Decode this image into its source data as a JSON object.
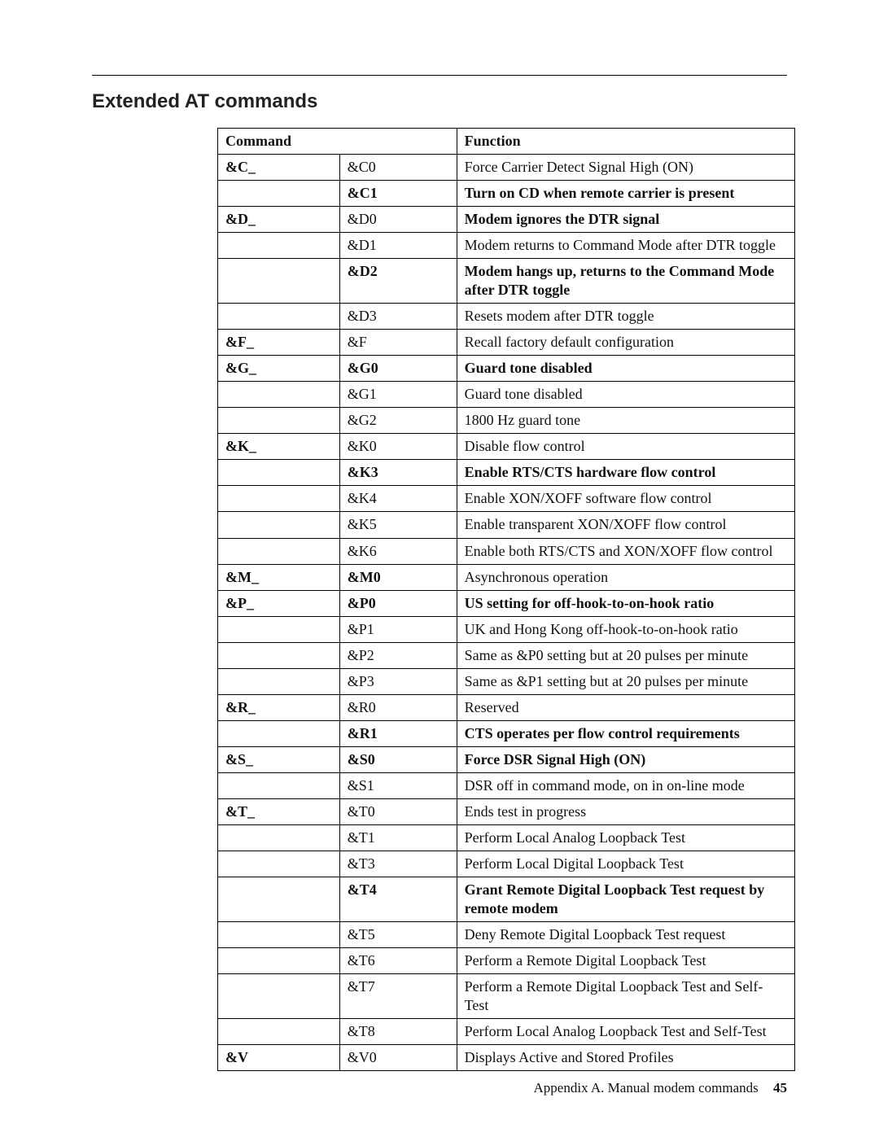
{
  "title": "Extended AT commands",
  "headers": {
    "command": "Command",
    "function": "Function"
  },
  "rows": [
    {
      "grp": "&C_",
      "cmd": "&C0",
      "func": "Force Carrier Detect Signal High (ON)",
      "grpBold": true
    },
    {
      "grp": "",
      "cmd": "&C1",
      "func": "Turn on CD when remote carrier is present",
      "cmdBold": true,
      "funcBold": true
    },
    {
      "grp": "&D_",
      "cmd": "&D0",
      "func": "Modem ignores the DTR signal",
      "grpBold": true,
      "funcBold": true
    },
    {
      "grp": "",
      "cmd": "&D1",
      "func": "Modem returns to Command Mode after DTR toggle"
    },
    {
      "grp": "",
      "cmd": "&D2",
      "func": "Modem hangs up, returns to the Command Mode after DTR toggle",
      "cmdBold": true,
      "funcBold": true
    },
    {
      "grp": "",
      "cmd": "&D3",
      "func": "Resets modem after DTR toggle"
    },
    {
      "grp": "&F_",
      "cmd": "&F",
      "func": "Recall factory default configuration",
      "grpBold": true
    },
    {
      "grp": "&G_",
      "cmd": "&G0",
      "func": "Guard tone disabled",
      "grpBold": true,
      "cmdBold": true,
      "funcBold": true
    },
    {
      "grp": "",
      "cmd": "&G1",
      "func": "Guard tone disabled"
    },
    {
      "grp": "",
      "cmd": "&G2",
      "func": "1800 Hz guard tone"
    },
    {
      "grp": "&K_",
      "cmd": "&K0",
      "func": "Disable flow control",
      "grpBold": true
    },
    {
      "grp": "",
      "cmd": "&K3",
      "func": "Enable RTS/CTS hardware flow control",
      "cmdBold": true,
      "funcBold": true
    },
    {
      "grp": "",
      "cmd": "&K4",
      "func": "Enable XON/XOFF software flow control"
    },
    {
      "grp": "",
      "cmd": "&K5",
      "func": "Enable transparent XON/XOFF flow control"
    },
    {
      "grp": "",
      "cmd": "&K6",
      "func": "Enable both RTS/CTS and XON/XOFF flow control"
    },
    {
      "grp": "&M_",
      "cmd": "&M0",
      "func": "Asynchronous operation",
      "grpBold": true,
      "cmdBold": true
    },
    {
      "grp": "&P_",
      "cmd": "&P0",
      "func": "US setting for off-hook-to-on-hook ratio",
      "grpBold": true,
      "cmdBold": true,
      "funcBold": true
    },
    {
      "grp": "",
      "cmd": "&P1",
      "func": "UK and Hong Kong off-hook-to-on-hook ratio"
    },
    {
      "grp": "",
      "cmd": "&P2",
      "func": "Same as &P0 setting but at 20 pulses per minute"
    },
    {
      "grp": "",
      "cmd": "&P3",
      "func": "Same as &P1 setting but at 20 pulses per minute"
    },
    {
      "grp": "&R_",
      "cmd": "&R0",
      "func": "Reserved",
      "grpBold": true
    },
    {
      "grp": "",
      "cmd": "&R1",
      "func": "CTS operates per flow control requirements",
      "cmdBold": true,
      "funcBold": true
    },
    {
      "grp": "&S_",
      "cmd": "&S0",
      "func": "Force DSR Signal High (ON)",
      "grpBold": true,
      "cmdBold": true,
      "funcBold": true
    },
    {
      "grp": "",
      "cmd": "&S1",
      "func": "DSR off in command mode, on in on-line mode"
    },
    {
      "grp": "&T_",
      "cmd": "&T0",
      "func": "Ends test in progress",
      "grpBold": true
    },
    {
      "grp": "",
      "cmd": "&T1",
      "func": "Perform Local Analog Loopback Test"
    },
    {
      "grp": "",
      "cmd": "&T3",
      "func": "Perform Local Digital Loopback Test"
    },
    {
      "grp": "",
      "cmd": "&T4",
      "func": "Grant Remote Digital Loopback Test request by remote modem",
      "cmdBold": true,
      "funcBold": true
    },
    {
      "grp": "",
      "cmd": "&T5",
      "func": "Deny Remote Digital Loopback Test request"
    },
    {
      "grp": "",
      "cmd": "&T6",
      "func": "Perform a Remote Digital Loopback Test"
    },
    {
      "grp": "",
      "cmd": "&T7",
      "func": "Perform a Remote Digital Loopback Test and Self-Test"
    },
    {
      "grp": "",
      "cmd": "&T8",
      "func": "Perform Local Analog Loopback Test and Self-Test"
    },
    {
      "grp": "&V",
      "cmd": "&V0",
      "func": "Displays Active and Stored Profiles",
      "grpBold": true
    }
  ],
  "footer": {
    "text": "Appendix A. Manual modem commands",
    "page": "45"
  }
}
